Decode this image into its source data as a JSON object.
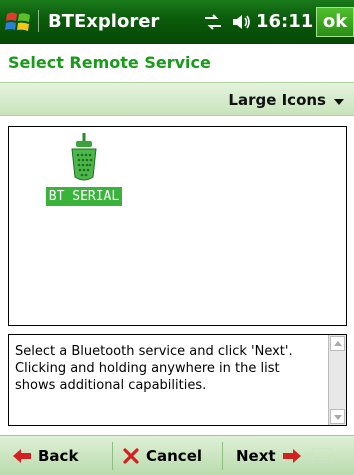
{
  "titlebar": {
    "app_title": "BTExplorer",
    "time": "16:11",
    "ok_label": "ok",
    "icons": [
      "windows-start-icon",
      "connectivity-icon",
      "speaker-icon"
    ]
  },
  "header": {
    "title": "Select Remote Service"
  },
  "toolbar": {
    "view_mode": "Large Icons"
  },
  "services": [
    {
      "label": "BT SERIAL",
      "icon": "serial-port-icon",
      "selected": true
    }
  ],
  "help": {
    "text": "Select a Bluetooth service and click 'Next'. Clicking and holding anywhere in the list shows additional capabilities."
  },
  "softkeys": {
    "back": "Back",
    "cancel": "Cancel",
    "next": "Next"
  },
  "colors": {
    "titlebar": "#0a5a0a",
    "accent": "#1a9a1a",
    "selection": "#39b339",
    "arrow": "#d42020"
  }
}
